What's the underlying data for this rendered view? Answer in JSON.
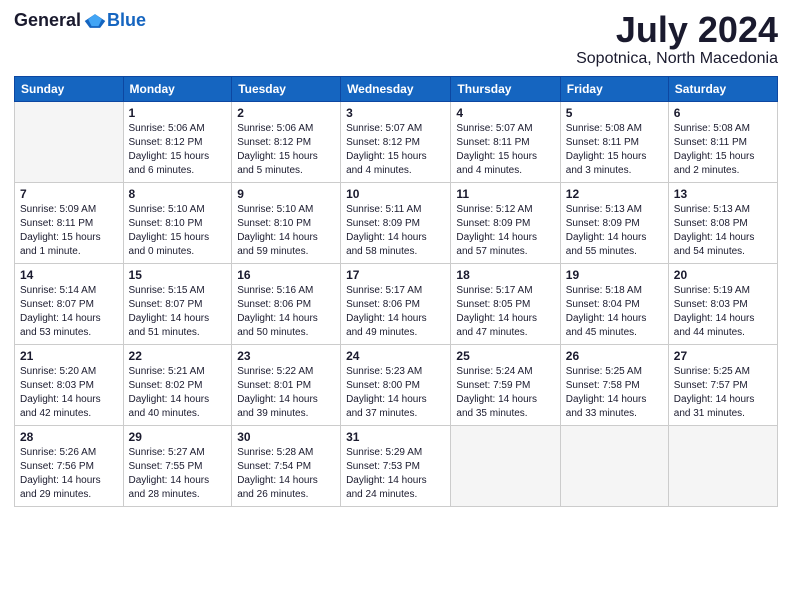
{
  "logo": {
    "general": "General",
    "blue": "Blue"
  },
  "header": {
    "title": "July 2024",
    "subtitle": "Sopotnica, North Macedonia"
  },
  "days_header": [
    "Sunday",
    "Monday",
    "Tuesday",
    "Wednesday",
    "Thursday",
    "Friday",
    "Saturday"
  ],
  "weeks": [
    [
      {
        "num": "",
        "info": ""
      },
      {
        "num": "1",
        "info": "Sunrise: 5:06 AM\nSunset: 8:12 PM\nDaylight: 15 hours\nand 6 minutes."
      },
      {
        "num": "2",
        "info": "Sunrise: 5:06 AM\nSunset: 8:12 PM\nDaylight: 15 hours\nand 5 minutes."
      },
      {
        "num": "3",
        "info": "Sunrise: 5:07 AM\nSunset: 8:12 PM\nDaylight: 15 hours\nand 4 minutes."
      },
      {
        "num": "4",
        "info": "Sunrise: 5:07 AM\nSunset: 8:11 PM\nDaylight: 15 hours\nand 4 minutes."
      },
      {
        "num": "5",
        "info": "Sunrise: 5:08 AM\nSunset: 8:11 PM\nDaylight: 15 hours\nand 3 minutes."
      },
      {
        "num": "6",
        "info": "Sunrise: 5:08 AM\nSunset: 8:11 PM\nDaylight: 15 hours\nand 2 minutes."
      }
    ],
    [
      {
        "num": "7",
        "info": "Sunrise: 5:09 AM\nSunset: 8:11 PM\nDaylight: 15 hours\nand 1 minute."
      },
      {
        "num": "8",
        "info": "Sunrise: 5:10 AM\nSunset: 8:10 PM\nDaylight: 15 hours\nand 0 minutes."
      },
      {
        "num": "9",
        "info": "Sunrise: 5:10 AM\nSunset: 8:10 PM\nDaylight: 14 hours\nand 59 minutes."
      },
      {
        "num": "10",
        "info": "Sunrise: 5:11 AM\nSunset: 8:09 PM\nDaylight: 14 hours\nand 58 minutes."
      },
      {
        "num": "11",
        "info": "Sunrise: 5:12 AM\nSunset: 8:09 PM\nDaylight: 14 hours\nand 57 minutes."
      },
      {
        "num": "12",
        "info": "Sunrise: 5:13 AM\nSunset: 8:09 PM\nDaylight: 14 hours\nand 55 minutes."
      },
      {
        "num": "13",
        "info": "Sunrise: 5:13 AM\nSunset: 8:08 PM\nDaylight: 14 hours\nand 54 minutes."
      }
    ],
    [
      {
        "num": "14",
        "info": "Sunrise: 5:14 AM\nSunset: 8:07 PM\nDaylight: 14 hours\nand 53 minutes."
      },
      {
        "num": "15",
        "info": "Sunrise: 5:15 AM\nSunset: 8:07 PM\nDaylight: 14 hours\nand 51 minutes."
      },
      {
        "num": "16",
        "info": "Sunrise: 5:16 AM\nSunset: 8:06 PM\nDaylight: 14 hours\nand 50 minutes."
      },
      {
        "num": "17",
        "info": "Sunrise: 5:17 AM\nSunset: 8:06 PM\nDaylight: 14 hours\nand 49 minutes."
      },
      {
        "num": "18",
        "info": "Sunrise: 5:17 AM\nSunset: 8:05 PM\nDaylight: 14 hours\nand 47 minutes."
      },
      {
        "num": "19",
        "info": "Sunrise: 5:18 AM\nSunset: 8:04 PM\nDaylight: 14 hours\nand 45 minutes."
      },
      {
        "num": "20",
        "info": "Sunrise: 5:19 AM\nSunset: 8:03 PM\nDaylight: 14 hours\nand 44 minutes."
      }
    ],
    [
      {
        "num": "21",
        "info": "Sunrise: 5:20 AM\nSunset: 8:03 PM\nDaylight: 14 hours\nand 42 minutes."
      },
      {
        "num": "22",
        "info": "Sunrise: 5:21 AM\nSunset: 8:02 PM\nDaylight: 14 hours\nand 40 minutes."
      },
      {
        "num": "23",
        "info": "Sunrise: 5:22 AM\nSunset: 8:01 PM\nDaylight: 14 hours\nand 39 minutes."
      },
      {
        "num": "24",
        "info": "Sunrise: 5:23 AM\nSunset: 8:00 PM\nDaylight: 14 hours\nand 37 minutes."
      },
      {
        "num": "25",
        "info": "Sunrise: 5:24 AM\nSunset: 7:59 PM\nDaylight: 14 hours\nand 35 minutes."
      },
      {
        "num": "26",
        "info": "Sunrise: 5:25 AM\nSunset: 7:58 PM\nDaylight: 14 hours\nand 33 minutes."
      },
      {
        "num": "27",
        "info": "Sunrise: 5:25 AM\nSunset: 7:57 PM\nDaylight: 14 hours\nand 31 minutes."
      }
    ],
    [
      {
        "num": "28",
        "info": "Sunrise: 5:26 AM\nSunset: 7:56 PM\nDaylight: 14 hours\nand 29 minutes."
      },
      {
        "num": "29",
        "info": "Sunrise: 5:27 AM\nSunset: 7:55 PM\nDaylight: 14 hours\nand 28 minutes."
      },
      {
        "num": "30",
        "info": "Sunrise: 5:28 AM\nSunset: 7:54 PM\nDaylight: 14 hours\nand 26 minutes."
      },
      {
        "num": "31",
        "info": "Sunrise: 5:29 AM\nSunset: 7:53 PM\nDaylight: 14 hours\nand 24 minutes."
      },
      {
        "num": "",
        "info": ""
      },
      {
        "num": "",
        "info": ""
      },
      {
        "num": "",
        "info": ""
      }
    ]
  ]
}
